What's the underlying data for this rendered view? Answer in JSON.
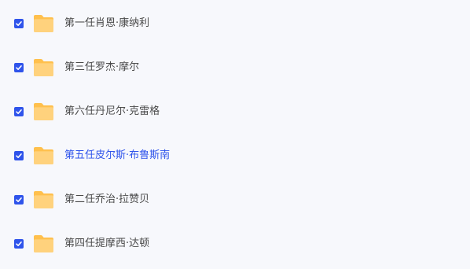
{
  "theme": {
    "checkbox_color": "#2f54eb",
    "folder_back": "#ffc04d",
    "folder_front": "#ffd27d",
    "text_color": "#4a4a4a",
    "active_text_color": "#2f54eb"
  },
  "files": [
    {
      "name": "第一任肖恩·康纳利",
      "checked": true,
      "icon": "folder-icon",
      "active": false
    },
    {
      "name": "第三任罗杰·摩尔",
      "checked": true,
      "icon": "folder-icon",
      "active": false
    },
    {
      "name": "第六任丹尼尔·克雷格",
      "checked": true,
      "icon": "folder-icon",
      "active": false
    },
    {
      "name": "第五任皮尔斯·布鲁斯南",
      "checked": true,
      "icon": "folder-icon",
      "active": true
    },
    {
      "name": "第二任乔治·拉赞贝",
      "checked": true,
      "icon": "folder-icon",
      "active": false
    },
    {
      "name": "第四任提摩西·达顿",
      "checked": true,
      "icon": "folder-icon",
      "active": false
    }
  ]
}
